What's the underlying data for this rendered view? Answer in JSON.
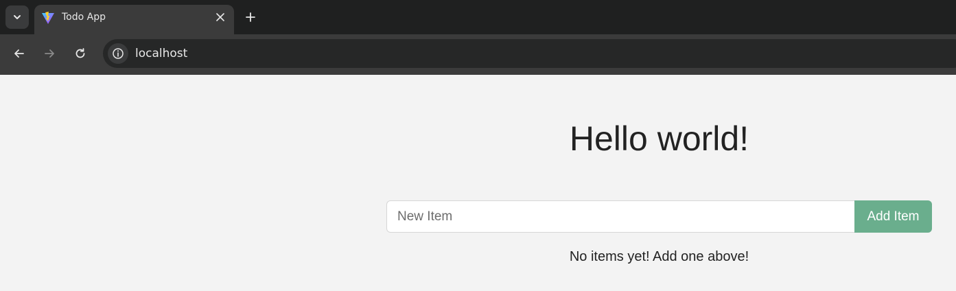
{
  "browser": {
    "tab_title": "Todo App",
    "url": "localhost",
    "icons": {
      "tab_search": "chevron-down-icon",
      "favicon": "vite-logo-icon",
      "close": "close-icon",
      "new_tab": "plus-icon",
      "back": "arrow-left-icon",
      "forward": "arrow-right-icon",
      "reload": "reload-icon",
      "site_info": "info-icon"
    },
    "colors": {
      "tabstrip": "#1f2020",
      "toolbar": "#3b3b3b",
      "omnibox": "#262727"
    }
  },
  "page": {
    "heading": "Hello world!",
    "new_item": {
      "placeholder": "New Item",
      "value": ""
    },
    "add_button_label": "Add Item",
    "empty_message": "No items yet! Add one above!",
    "colors": {
      "accent": "#6aae8d",
      "background": "#f3f3f3"
    }
  }
}
